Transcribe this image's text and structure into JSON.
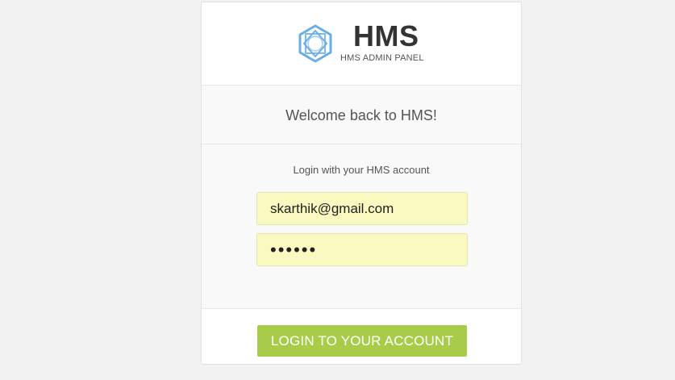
{
  "brand": {
    "title": "HMS",
    "subtitle": "HMS ADMIN PANEL",
    "logo_icon": "hexagon-star-logo-icon",
    "logo_color": "#6aaee6"
  },
  "welcome": {
    "text": "Welcome back to HMS!"
  },
  "login_form": {
    "caption": "Login with your HMS account",
    "email_value": "skarthik@gmail.com",
    "password_value": "••••••",
    "field_background": "#fafac0"
  },
  "actions": {
    "login_label": "LOGIN TO YOUR ACCOUNT",
    "login_color": "#a8cc4a"
  }
}
